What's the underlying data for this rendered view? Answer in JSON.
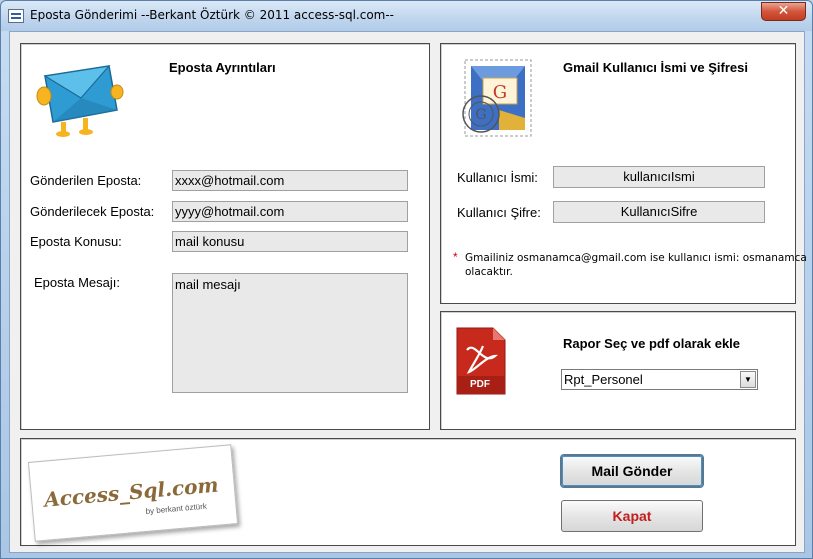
{
  "window": {
    "title": "Eposta Gönderimi --Berkant Öztürk  © 2011  access-sql.com--",
    "close_label": "✕"
  },
  "email_panel": {
    "heading": "Eposta Ayrıntıları",
    "sender_label": "Gönderilen Eposta:",
    "sender_value": "xxxx@hotmail.com",
    "recipient_label": "Gönderilecek Eposta:",
    "recipient_value": "yyyy@hotmail.com",
    "subject_label": "Eposta Konusu:",
    "subject_value": "mail konusu",
    "message_label": "Eposta Mesajı:",
    "message_value": "mail mesajı"
  },
  "gmail_panel": {
    "heading": "Gmail Kullanıcı İsmi ve Şifresi",
    "username_label": "Kullanıcı İsmi:",
    "username_value": "kullanıcıIsmi",
    "password_label": "Kullanıcı Şifre:",
    "password_value": "KullanıcıSifre",
    "note_star": "*",
    "note_line1": "Gmailiniz osmanamca@gmail.com ise kullanıcı ismi: osmanamca",
    "note_line2": "olacaktır."
  },
  "report_panel": {
    "heading": "Rapor Seç ve pdf olarak ekle",
    "selected_report": "Rpt_Personel",
    "pdf_icon_text": "PDF"
  },
  "footer": {
    "logo_text": "Access_Sql.com",
    "logo_byline": "by berkant öztürk",
    "send_button": "Mail Gönder",
    "close_button": "Kapat"
  },
  "colors": {
    "title_bar": "#c7dcf2",
    "close_button": "#d2553b",
    "field_bg": "#e9e9e9",
    "close_text": "#c0201e",
    "pdf_red": "#c8291d"
  }
}
